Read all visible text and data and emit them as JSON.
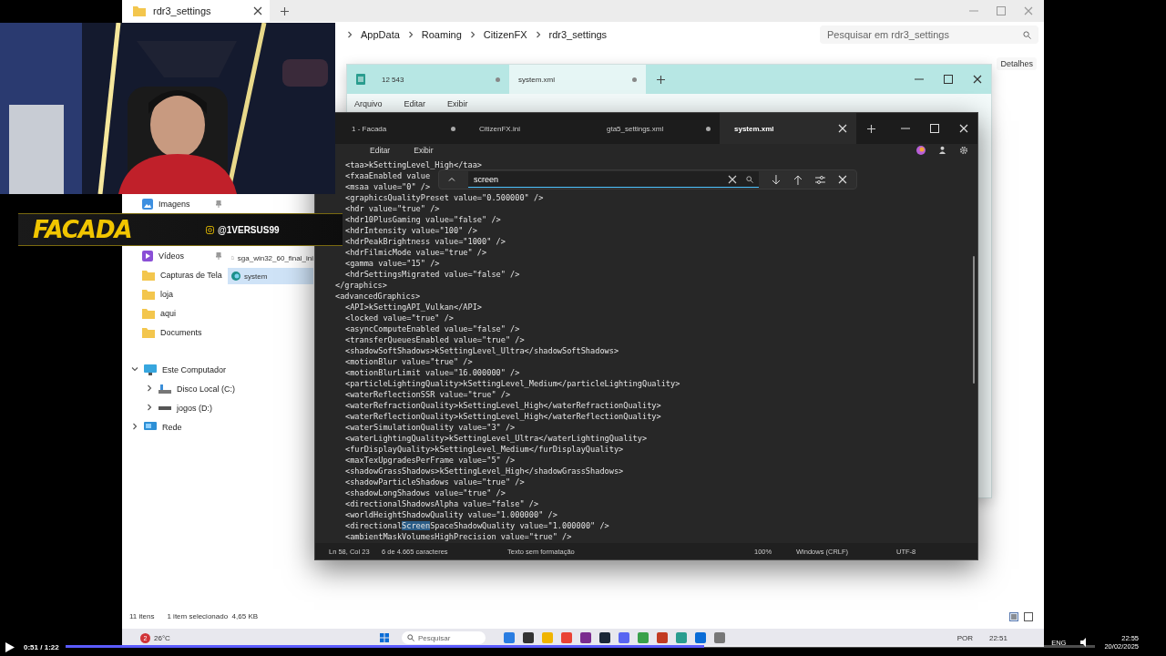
{
  "explorer": {
    "tab": "rdr3_settings",
    "breadcrumb": [
      "AppData",
      "Roaming",
      "CitizenFX",
      "rdr3_settings"
    ],
    "search": {
      "placeholder": "Pesquisar em rdr3_settings"
    },
    "details_button": "Detalhes",
    "quick_access": [
      {
        "label": "Imagens",
        "kind": "images",
        "pinned": true
      },
      {
        "label": "Vídeos",
        "kind": "videos",
        "pinned": true
      },
      {
        "label": "Capturas de Tela",
        "kind": "folder",
        "pinned": false
      },
      {
        "label": "loja",
        "kind": "folder",
        "pinned": false
      },
      {
        "label": "aqui",
        "kind": "folder",
        "pinned": false
      },
      {
        "label": "Documents",
        "kind": "folder",
        "pinned": false
      }
    ],
    "tree": [
      {
        "label": "Este Computador",
        "kind": "computer",
        "expanded": true,
        "children": [
          {
            "label": "Disco Local (C:)",
            "kind": "disk",
            "expanded": false
          },
          {
            "label": "jogos (D:)",
            "kind": "drive",
            "expanded": false
          }
        ]
      },
      {
        "label": "Rede",
        "kind": "network",
        "expanded": false
      }
    ],
    "files": [
      {
        "name": "sga_win32_60_final_ini",
        "kind": "file",
        "selected": false
      },
      {
        "name": "system",
        "kind": "edge",
        "selected": true
      }
    ],
    "status": {
      "count": "11 itens",
      "selection": "1 item selecionado  4,65 KB"
    }
  },
  "back_notepad": {
    "tabs": [
      {
        "label": "12 543",
        "selected": false
      },
      {
        "label": "system.xml",
        "selected": true
      }
    ],
    "menu": [
      "Arquivo",
      "Editar",
      "Exibir"
    ]
  },
  "notepad": {
    "tabs": [
      {
        "label": "1 - Facada",
        "selected": false,
        "modified": true
      },
      {
        "label": "CitizenFX.ini",
        "selected": false,
        "modified": false
      },
      {
        "label": "gta5_settings.xml",
        "selected": false,
        "modified": true
      },
      {
        "label": "system.xml",
        "selected": true,
        "modified": false
      }
    ],
    "menu": [
      "Editar",
      "Exibir"
    ],
    "find": {
      "value": "screen"
    },
    "lines": [
      {
        "text": "<taa>kSettingLevel_High</taa>"
      },
      {
        "text": "<fxaaEnabled value"
      },
      {
        "text": "<msaa value=\"0\" />"
      },
      {
        "text": "<graphicsQualityPreset value=\"0.500000\" />"
      },
      {
        "text": "<hdr value=\"true\" />"
      },
      {
        "text": "<hdr10PlusGaming value=\"false\" />"
      },
      {
        "text": "<hdrIntensity value=\"100\" />"
      },
      {
        "text": "<hdrPeakBrightness value=\"1000\" />"
      },
      {
        "text": "<hdrFilmicMode value=\"true\" />"
      },
      {
        "text": "<gamma value=\"15\" />"
      },
      {
        "text": "<hdrSettingsMigrated value=\"false\" />"
      },
      {
        "text": "</graphics>",
        "outer": true
      },
      {
        "text": "<advancedGraphics>",
        "outer": true
      },
      {
        "text": "<API>kSettingAPI_Vulkan</API>"
      },
      {
        "text": "<locked value=\"true\" />"
      },
      {
        "text": "<asyncComputeEnabled value=\"false\" />"
      },
      {
        "text": "<transferQueuesEnabled value=\"true\" />"
      },
      {
        "text": "<shadowSoftShadows>kSettingLevel_Ultra</shadowSoftShadows>"
      },
      {
        "text": "<motionBlur value=\"true\" />"
      },
      {
        "text": "<motionBlurLimit value=\"16.000000\" />"
      },
      {
        "text": "<particleLightingQuality>kSettingLevel_Medium</particleLightingQuality>"
      },
      {
        "text": "<waterReflectionSSR value=\"true\" />"
      },
      {
        "text": "<waterRefractionQuality>kSettingLevel_High</waterRefractionQuality>"
      },
      {
        "text": "<waterReflectionQuality>kSettingLevel_High</waterReflectionQuality>"
      },
      {
        "text": "<waterSimulationQuality value=\"3\" />"
      },
      {
        "text": "<waterLightingQuality>kSettingLevel_Ultra</waterLightingQuality>"
      },
      {
        "text": "<furDisplayQuality>kSettingLevel_Medium</furDisplayQuality>"
      },
      {
        "text": "<maxTexUpgradesPerFrame value=\"5\" />"
      },
      {
        "text": "<shadowGrassShadows>kSettingLevel_High</shadowGrassShadows>"
      },
      {
        "text": "<shadowParticleShadows value=\"true\" />"
      },
      {
        "text": "<shadowLongShadows value=\"true\" />"
      },
      {
        "text": "<directionalShadowsAlpha value=\"false\" />"
      },
      {
        "text": "<worldHeightShadowQuality value=\"1.000000\" />"
      },
      {
        "text": "<directional",
        "match": "Screen",
        "rest": "SpaceShadowQuality value=\"1.000000\" />"
      },
      {
        "text": "<ambientMaskVolumesHighPrecision value=\"true\" />"
      }
    ],
    "status": [
      "Ln 58, Col 23",
      "6 de 4.665 caracteres",
      "Texto sem formatação",
      "100%",
      "Windows (CRLF)",
      "UTF-8"
    ]
  },
  "webcam": {
    "kind": "picture",
    "handle": "@1VERSUS99",
    "logo": "FACADA"
  },
  "taskbar": {
    "weather": "26°C",
    "alerts": "2",
    "search": {
      "placeholder": "Pesquisar"
    },
    "language": "POR",
    "time": "22:51"
  },
  "player": {
    "time": "0:51 / 1:22",
    "level": 0.62
  },
  "tray": {
    "language": "ENG",
    "time": "22:55",
    "date": "20/02/2025"
  }
}
